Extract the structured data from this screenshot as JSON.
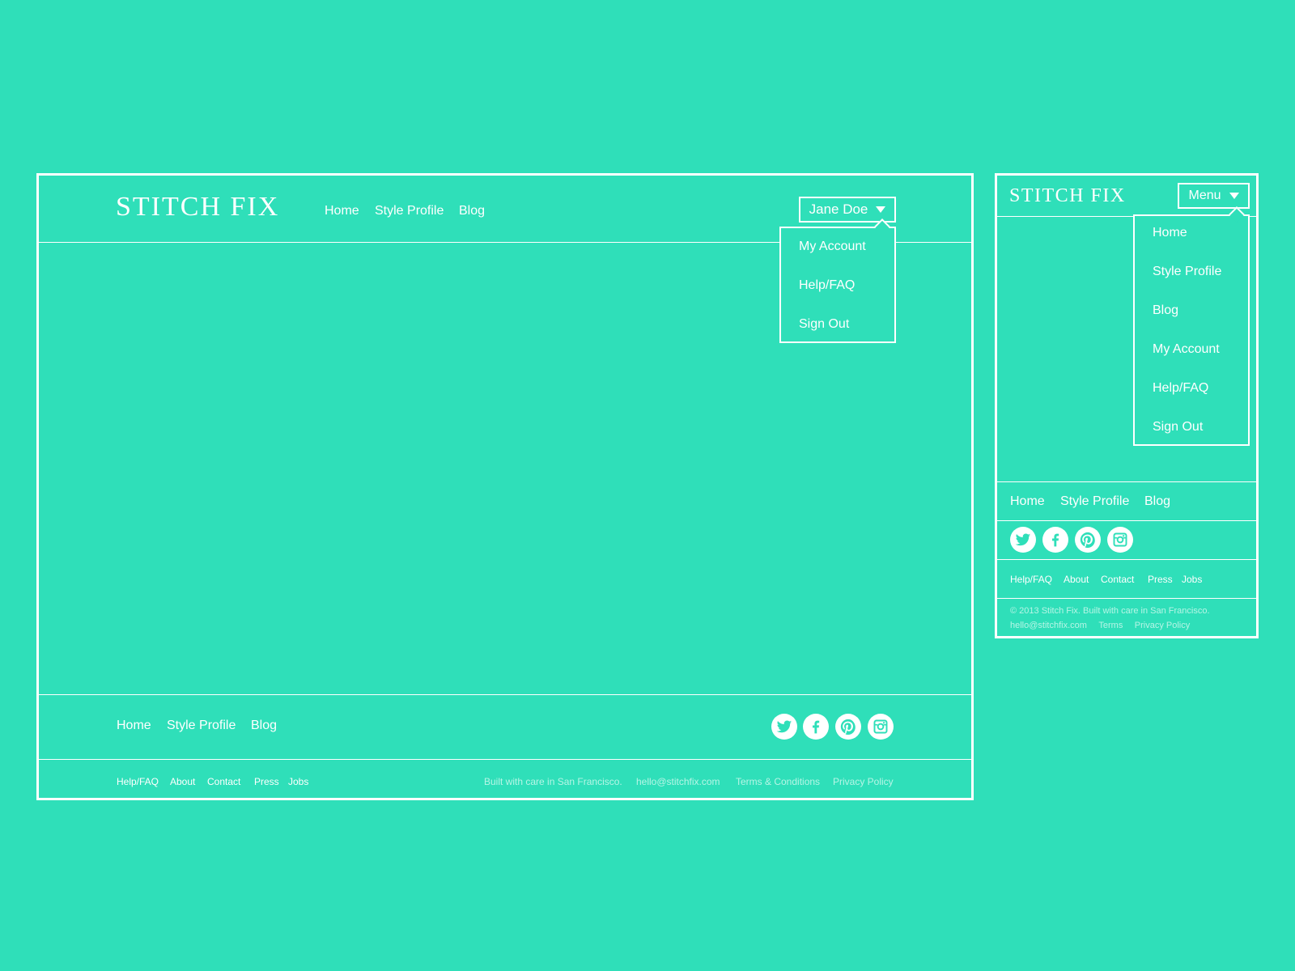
{
  "colors": {
    "background": "#2fdfb9",
    "foreground": "#ffffff",
    "muted_text": "#b7f5e6"
  },
  "desktop": {
    "logo": "STITCH FIX",
    "nav": [
      "Home",
      "Style Profile",
      "Blog"
    ],
    "user_button": {
      "label": "Jane Doe",
      "icon": "caret-down-icon"
    },
    "user_menu": [
      "My Account",
      "Help/FAQ",
      "Sign Out"
    ],
    "footer_nav": [
      "Home",
      "Style Profile",
      "Blog"
    ],
    "social": [
      "twitter-icon",
      "facebook-icon",
      "pinterest-icon",
      "instagram-icon"
    ],
    "footer_links": [
      "Help/FAQ",
      "About",
      "Contact",
      "Press",
      "Jobs"
    ],
    "footer_info": {
      "built": "Built with care in San Francisco.",
      "email": "hello@stitchfix.com",
      "terms": "Terms & Conditions",
      "privacy": "Privacy Policy"
    }
  },
  "mobile": {
    "logo": "STITCH FIX",
    "menu_button": {
      "label": "Menu",
      "icon": "caret-down-icon"
    },
    "menu": [
      "Home",
      "Style Profile",
      "Blog",
      "My Account",
      "Help/FAQ",
      "Sign Out"
    ],
    "footer_nav": [
      "Home",
      "Style Profile",
      "Blog"
    ],
    "social": [
      "twitter-icon",
      "facebook-icon",
      "pinterest-icon",
      "instagram-icon"
    ],
    "footer_links": [
      "Help/FAQ",
      "About",
      "Contact",
      "Press",
      "Jobs"
    ],
    "footer_info": {
      "copyright": "© 2013 Stitch Fix. Built with care in San Francisco.",
      "email": "hello@stitchfix.com",
      "terms": "Terms",
      "privacy": "Privacy Policy"
    }
  }
}
